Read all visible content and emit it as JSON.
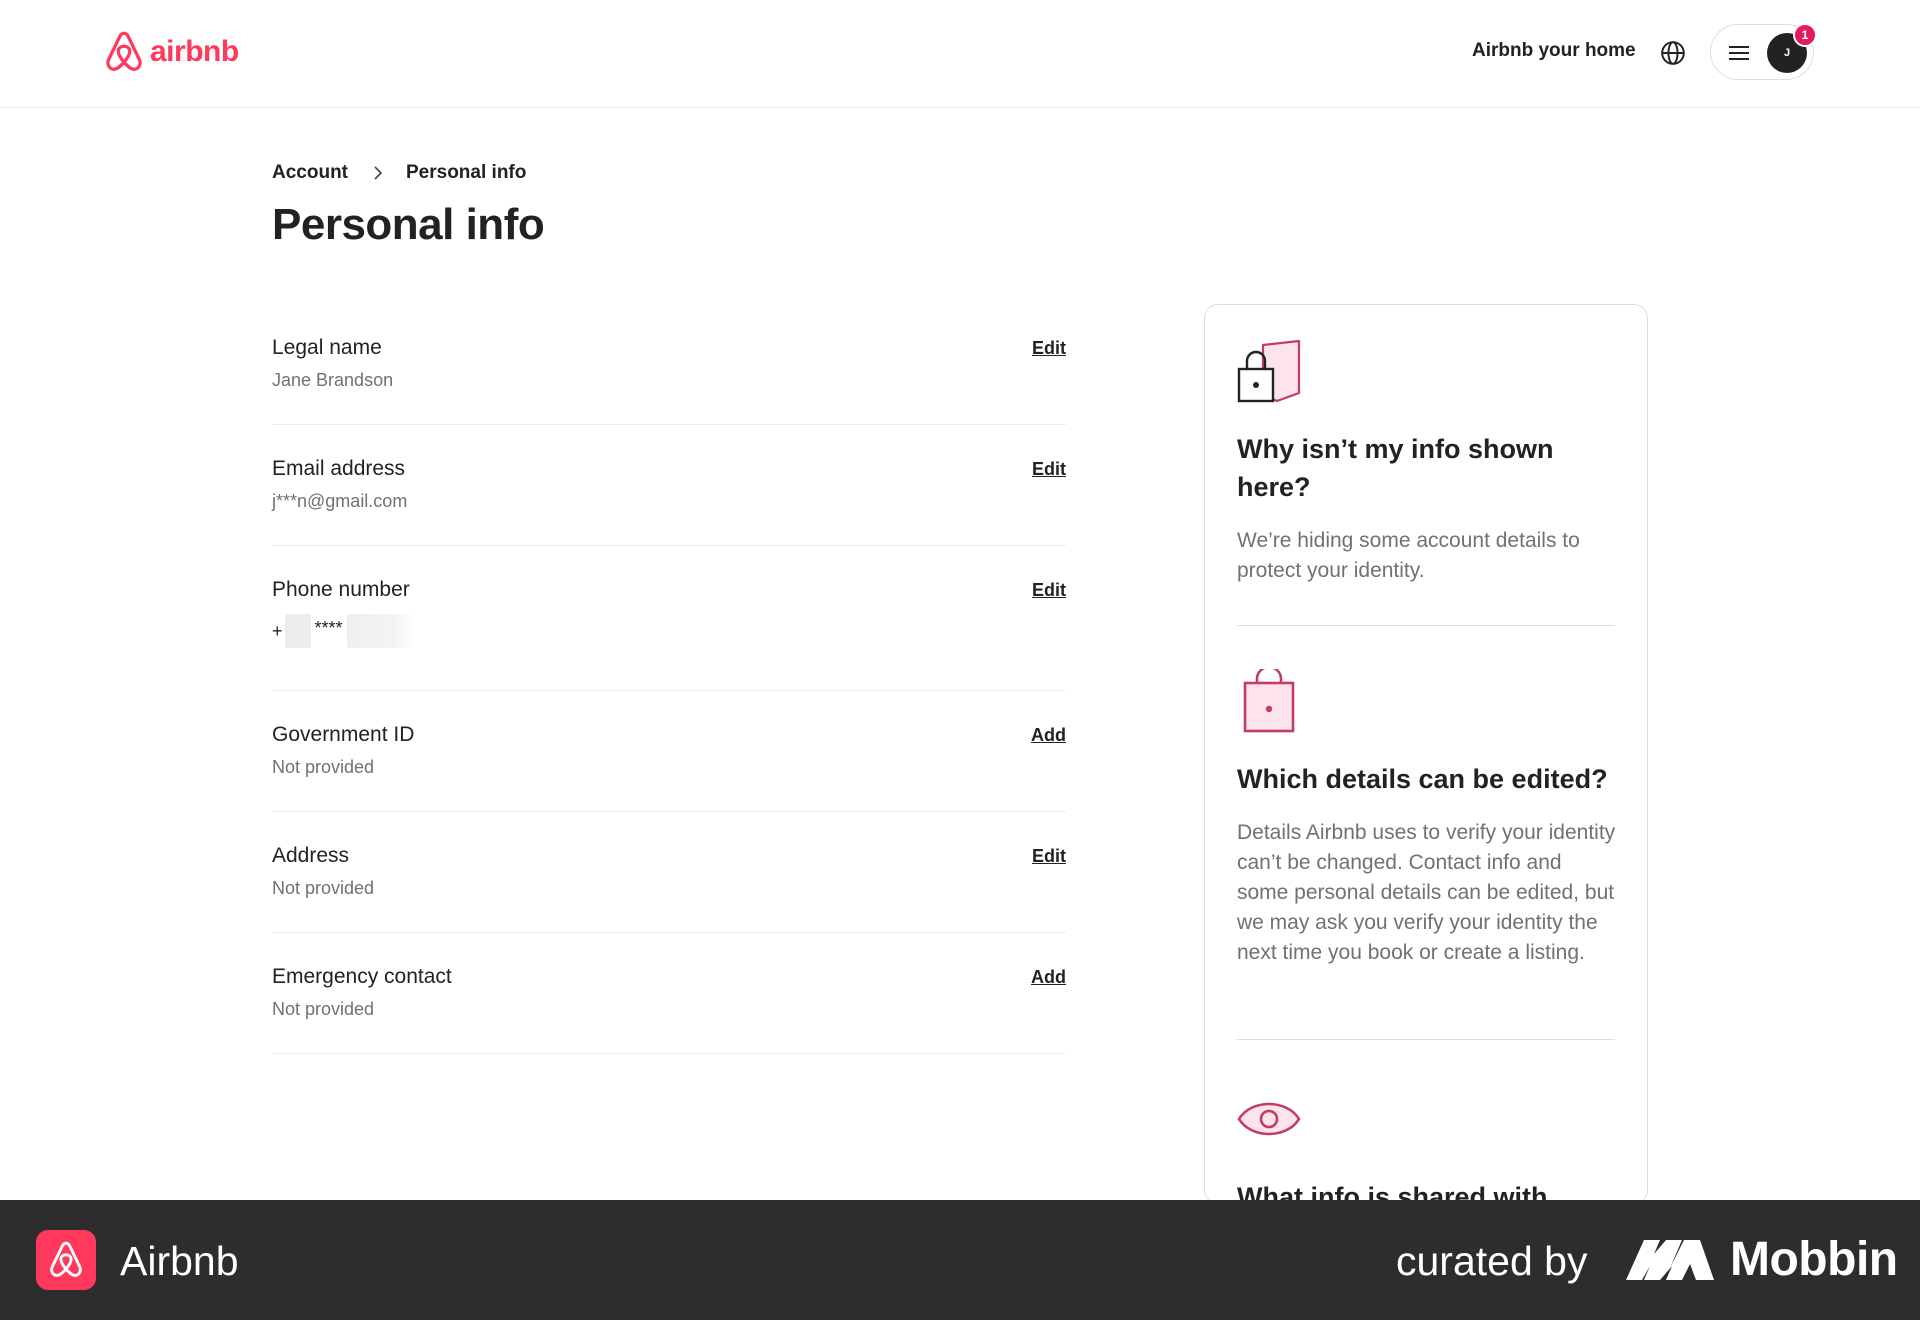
{
  "header": {
    "logo_text": "airbnb",
    "host_link": "Airbnb your home",
    "avatar_initial": "J",
    "notification_count": "1"
  },
  "breadcrumb": {
    "parent": "Account",
    "current": "Personal info"
  },
  "page_title": "Personal info",
  "info_rows": [
    {
      "label": "Legal name",
      "value": "Jane Brandson",
      "action": "Edit"
    },
    {
      "label": "Email address",
      "value": "j***n@gmail.com",
      "action": "Edit"
    },
    {
      "label": "Phone number",
      "value_prefix": "+",
      "value_mask": "****",
      "action": "Edit"
    },
    {
      "label": "Government ID",
      "value": "Not provided",
      "action": "Add"
    },
    {
      "label": "Address",
      "value": "Not provided",
      "action": "Edit"
    },
    {
      "label": "Emergency contact",
      "value": "Not provided",
      "action": "Add"
    }
  ],
  "side_card": {
    "sections": [
      {
        "icon": "lock-shield-icon",
        "heading": "Why isn’t my info shown here?",
        "text": "We’re hiding some account details to protect your identity."
      },
      {
        "icon": "lock-bag-icon",
        "heading": "Which details can be edited?",
        "text": "Details Airbnb uses to verify your identity can’t be changed. Contact info and some personal details can be edited, but we may ask you verify your identity the next time you book or create a listing."
      },
      {
        "icon": "eye-icon",
        "heading": "What info is shared with"
      }
    ]
  },
  "footer": {
    "app_name": "Airbnb",
    "curated_by": "curated by",
    "brand": "Mobbin"
  },
  "colors": {
    "brand": "#ff385c",
    "accent_pink": "#e31c5f",
    "text_primary": "#222222",
    "text_secondary": "#717171",
    "footer_bg": "#2d2d2d"
  }
}
